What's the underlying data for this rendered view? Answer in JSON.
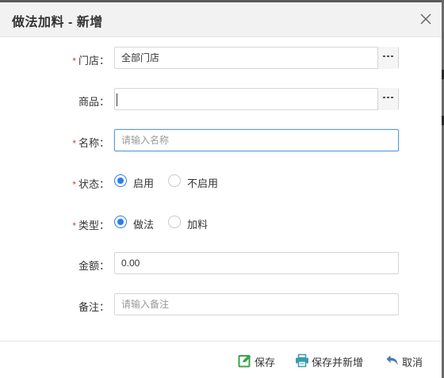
{
  "dialog": {
    "title": "做法加料 - 新增"
  },
  "form": {
    "store": {
      "label": "门店：",
      "value": "全部门店"
    },
    "product": {
      "label": "商品：",
      "value": ""
    },
    "name": {
      "label": "名称：",
      "placeholder": "请输入名称"
    },
    "status": {
      "label": "状态：",
      "options": [
        "启用",
        "不启用"
      ],
      "selected": "启用"
    },
    "type": {
      "label": "类型：",
      "options": [
        "做法",
        "加料"
      ],
      "selected": "做法"
    },
    "amount": {
      "label": "金额：",
      "value": "0.00"
    },
    "remark": {
      "label": "备注：",
      "placeholder": "请输入备注"
    },
    "required_mark": "*"
  },
  "footer": {
    "save": "保存",
    "save_new": "保存并新增",
    "cancel": "取消"
  },
  "colors": {
    "required": "#e03a3a",
    "radio": "#2b7de9",
    "save_icon": "#3aa34a",
    "save_new_icon": "#3a9bb0",
    "cancel_icon": "#4a7ab0"
  },
  "icons": {
    "close": "close-icon",
    "lookup": "ellipsis-icon",
    "save": "edit-icon",
    "save_new": "printer-icon",
    "cancel": "undo-icon"
  }
}
